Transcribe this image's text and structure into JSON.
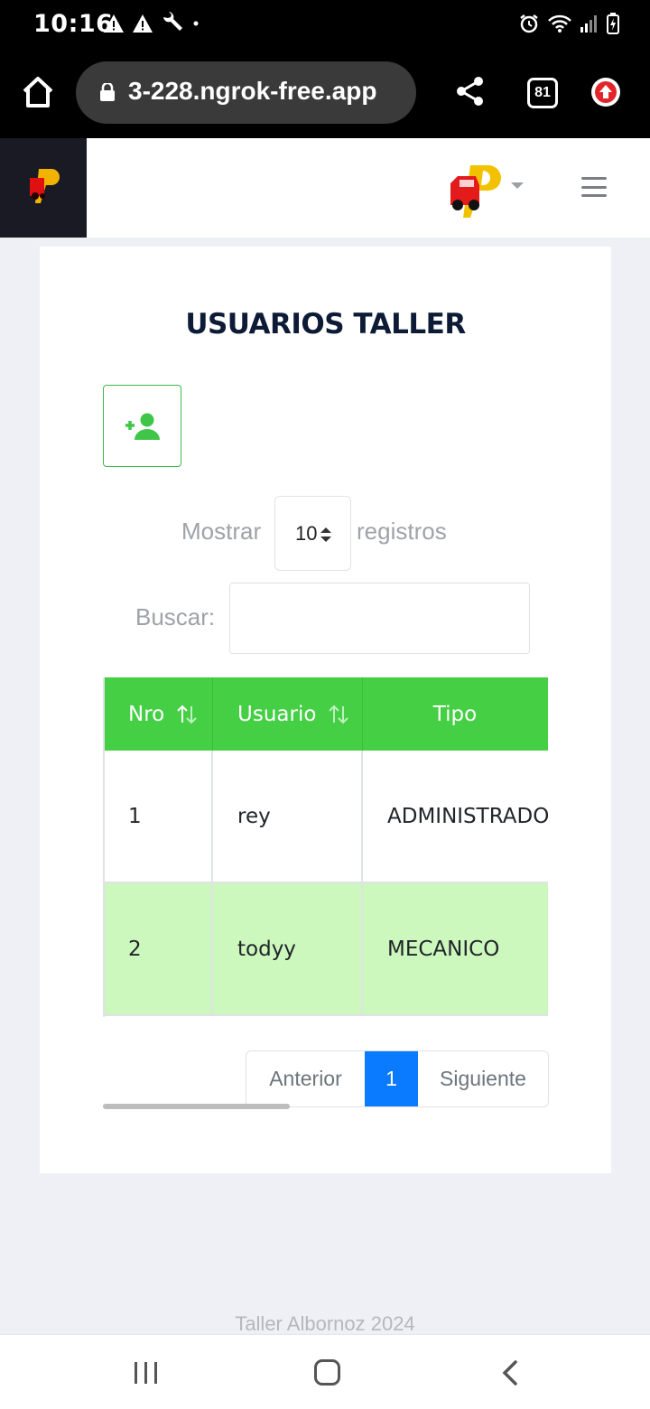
{
  "status_bar": {
    "time": "10:16"
  },
  "browser": {
    "url": "3-228.ngrok-free.app",
    "tab_count": "81"
  },
  "page": {
    "title": "USUARIOS TALLER",
    "show_label": "Mostrar",
    "length_value": "10",
    "records_label": "registros",
    "search_label": "Buscar:",
    "search_value": ""
  },
  "table": {
    "headers": [
      "Nro",
      "Usuario",
      "Tipo"
    ],
    "rows": [
      [
        "1",
        "rey",
        "ADMINISTRADOR"
      ],
      [
        "2",
        "todyy",
        "MECANICO"
      ]
    ]
  },
  "pagination": {
    "prev": "Anterior",
    "current": "1",
    "next": "Siguiente"
  },
  "footer": {
    "text": "Taller Albornoz 2024"
  },
  "colors": {
    "accent_green": "#45cf45",
    "row_highlight": "#ccf8be",
    "page_active": "#0a7bff",
    "sidebar_dark": "#191a23"
  }
}
